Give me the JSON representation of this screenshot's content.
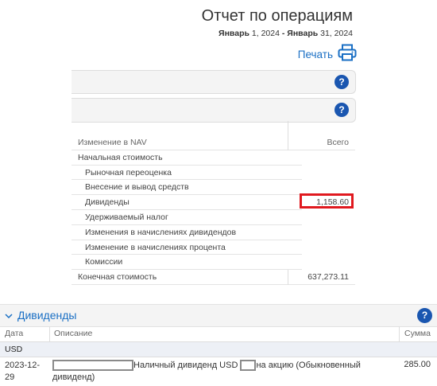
{
  "header": {
    "title": "Отчет по операциям",
    "date_from": "Январь",
    "date_from_num": "1, 2024",
    "date_sep": "-",
    "date_to": "Январь",
    "date_to_num": "31, 2024",
    "print_label": "Печать"
  },
  "help_label": "?",
  "nav": {
    "col_label": "Изменение в NAV",
    "col_total": "Всего",
    "rows": [
      {
        "label": "Начальная стоимость",
        "value": ""
      },
      {
        "label": "Рыночная переоценка",
        "value": ""
      },
      {
        "label": "Внесение и вывод средств",
        "value": ""
      },
      {
        "label": "Дивиденды",
        "value": "1,158.60"
      },
      {
        "label": "Удерживаемый налог",
        "value": ""
      },
      {
        "label": "Изменения в начислениях дивидендов",
        "value": ""
      },
      {
        "label": "Изменение в начислениях процента",
        "value": ""
      },
      {
        "label": "Комиссии",
        "value": ""
      },
      {
        "label": "Конечная стоимость",
        "value": "637,273.11"
      }
    ]
  },
  "dividends": {
    "title": "Дивиденды",
    "columns": {
      "date": "Дата",
      "description": "Описание",
      "amount": "Сумма"
    },
    "currency": "USD",
    "row": {
      "date": "2023-12-29",
      "desc_mid": "Наличный дивиденд USD",
      "desc_end": "на акцию (Обыкновенный дивиденд)",
      "amount": "285.00"
    }
  },
  "colors": {
    "accent": "#1a6fc4",
    "help_bg": "#1a56b0",
    "highlight": "#e0191f"
  }
}
